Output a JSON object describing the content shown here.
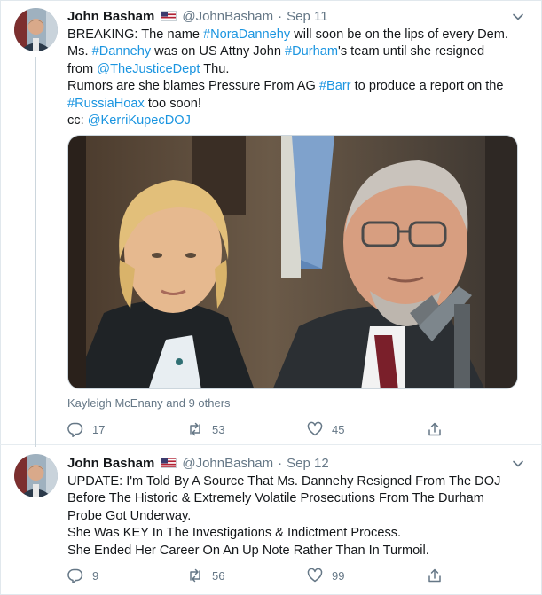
{
  "tweets": [
    {
      "author_name": "John Basham",
      "author_handle": "@JohnBasham",
      "date": "Sep 11",
      "flag_icon": "us-flag-icon",
      "avatar_icon": "avatar-photo",
      "body_parts": [
        {
          "text": "BREAKING: The name ",
          "link": false
        },
        {
          "text": "#NoraDannehy",
          "link": true
        },
        {
          "text": " will soon be on the lips of every Dem.\nMs. ",
          "link": false
        },
        {
          "text": "#Dannehy",
          "link": true
        },
        {
          "text": " was on US Attny John ",
          "link": false
        },
        {
          "text": "#Durham",
          "link": true
        },
        {
          "text": "'s team until she resigned\nfrom ",
          "link": false
        },
        {
          "text": "@TheJusticeDept",
          "link": true
        },
        {
          "text": " Thu.\nRumors are she blames Pressure From AG ",
          "link": false
        },
        {
          "text": "#Barr",
          "link": true
        },
        {
          "text": " to produce a report on the\n",
          "link": false
        },
        {
          "text": "#RussiaHoax",
          "link": true
        },
        {
          "text": " too soon!\ncc: ",
          "link": false
        },
        {
          "text": "@KerriKupecDOJ",
          "link": true
        }
      ],
      "liked_by": "Kayleigh McEnany and 9 others",
      "stats": {
        "replies": "17",
        "retweets": "53",
        "likes": "45"
      }
    },
    {
      "author_name": "John Basham",
      "author_handle": "@JohnBasham",
      "date": "Sep 12",
      "flag_icon": "us-flag-icon",
      "avatar_icon": "avatar-photo",
      "body_parts": [
        {
          "text": "UPDATE: I'm Told By A Source That Ms. Dannehy Resigned From The DOJ\nBefore The Historic & Extremely Volatile Prosecutions From The Durham\nProbe Got Underway.\nShe Was KEY In The Investigations & Indictment Process.\nShe Ended Her Career On An Up Note Rather Than In Turmoil.",
          "link": false
        }
      ],
      "stats": {
        "replies": "9",
        "retweets": "56",
        "likes": "99"
      }
    }
  ],
  "colors": {
    "link": "#1b95e0",
    "muted": "#657786",
    "border": "#e6ecf0"
  },
  "icons": {
    "reply": "reply-icon",
    "retweet": "retweet-icon",
    "like": "heart-icon",
    "share": "share-icon",
    "more": "chevron-down-icon"
  }
}
